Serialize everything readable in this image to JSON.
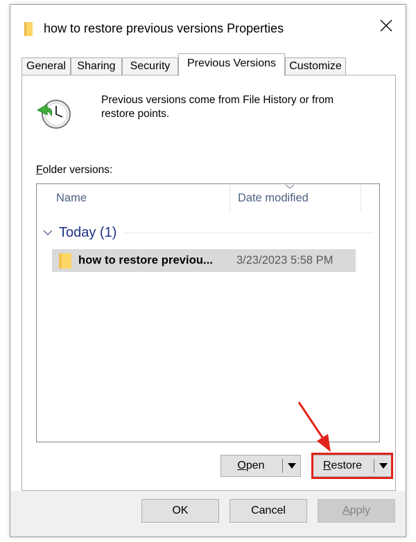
{
  "window": {
    "title": "how to restore previous versions Properties"
  },
  "tabs": [
    {
      "label": "General",
      "active": false
    },
    {
      "label": "Sharing",
      "active": false
    },
    {
      "label": "Security",
      "active": false
    },
    {
      "label": "Previous Versions",
      "active": true
    },
    {
      "label": "Customize",
      "active": false
    }
  ],
  "panel": {
    "info_line1": "Previous versions come from File History or from",
    "info_line2": "restore points.",
    "folder_label_prefix": "F",
    "folder_label_rest": "older versions:",
    "columns": [
      "Name",
      "Date modified"
    ],
    "group": {
      "title": "Today (1)"
    },
    "rows": [
      {
        "name": "how to restore previou...",
        "date": "3/23/2023 5:58 PM"
      }
    ],
    "open_btn": {
      "mnemonic": "O",
      "rest": "pen"
    },
    "restore_btn": {
      "mnemonic": "R",
      "rest": "estore"
    }
  },
  "bottom": {
    "ok": "OK",
    "cancel": "Cancel",
    "apply_mnemonic": "A",
    "apply_rest": "pply"
  },
  "colors": {
    "highlight": "#e0241b",
    "folder": "#ffd666",
    "group_text": "#1e3287",
    "header_text": "#4d6082",
    "selected_row": "#d9d9d9"
  },
  "icons": {
    "title": "folder-icon",
    "close": "close-icon",
    "info": "restore-clock-icon",
    "row": "folder-icon"
  }
}
